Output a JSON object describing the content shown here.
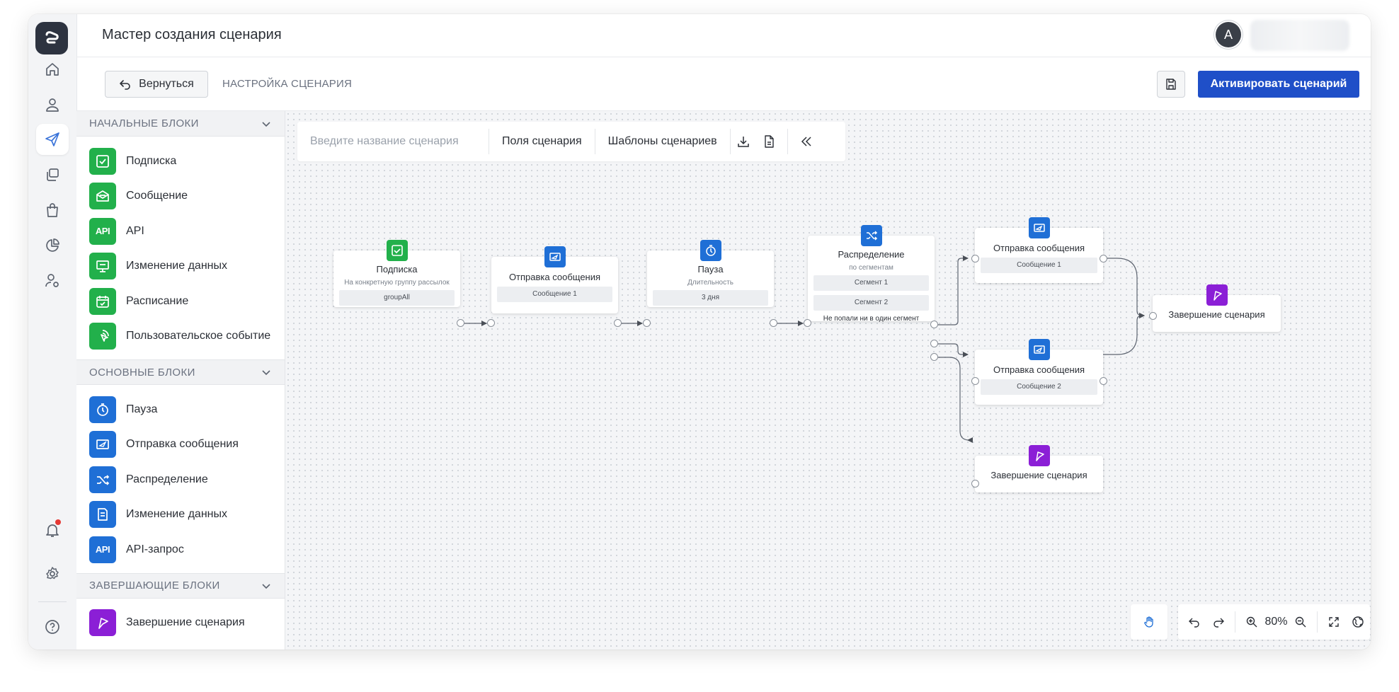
{
  "header": {
    "title": "Мастер создания сценария",
    "avatar_letter": "A"
  },
  "toolbar": {
    "back_label": "Вернуться",
    "breadcrumb": "НАСТРОЙКА СЦЕНАРИЯ",
    "activate_label": "Активировать сценарий"
  },
  "palette": {
    "sections": [
      {
        "title": "НАЧАЛЬНЫЕ БЛОКИ",
        "items": [
          {
            "label": "Подписка",
            "icon": "check-square-icon",
            "color": "#22b04b"
          },
          {
            "label": "Сообщение",
            "icon": "envelope-open-icon",
            "color": "#22b04b"
          },
          {
            "label": "API",
            "icon": "api-icon",
            "color": "#22b04b"
          },
          {
            "label": "Изменение данных",
            "icon": "data-edit-icon",
            "color": "#22b04b"
          },
          {
            "label": "Расписание",
            "icon": "calendar-icon",
            "color": "#22b04b"
          },
          {
            "label": "Пользовательское событие",
            "icon": "pointer-click-icon",
            "color": "#22b04b"
          }
        ]
      },
      {
        "title": "ОСНОВНЫЕ БЛОКИ",
        "items": [
          {
            "label": "Пауза",
            "icon": "timer-icon",
            "color": "#1f6fd6"
          },
          {
            "label": "Отправка сообщения",
            "icon": "message-send-icon",
            "color": "#1f6fd6"
          },
          {
            "label": "Распределение",
            "icon": "shuffle-icon",
            "color": "#1f6fd6"
          },
          {
            "label": "Изменение данных",
            "icon": "data-edit-icon",
            "color": "#1f6fd6"
          },
          {
            "label": "API-запрос",
            "icon": "api-icon",
            "color": "#1f6fd6"
          }
        ]
      },
      {
        "title": "ЗАВЕРШАЮЩИЕ БЛОКИ",
        "items": [
          {
            "label": "Завершение сценария",
            "icon": "flag-icon",
            "color": "#8b1fd6"
          }
        ]
      }
    ]
  },
  "canvas_toolbar": {
    "name_placeholder": "Введите название сценария",
    "fields_label": "Поля сценария",
    "templates_label": "Шаблоны сценариев"
  },
  "nodes": {
    "subscribe": {
      "title": "Подписка",
      "sub": "На конкретную группу рассылок",
      "chip": "groupAll"
    },
    "send1": {
      "title": "Отправка сообщения",
      "chip": "Сообщение 1"
    },
    "pause": {
      "title": "Пауза",
      "sub": "Длительность",
      "chip": "3 дня"
    },
    "distribution": {
      "title": "Распределение",
      "sub": "по сегментам",
      "seg1": "Сегмент 1",
      "seg2": "Сегмент 2",
      "seg3": "Не попали ни в один сегмент"
    },
    "send_top": {
      "title": "Отправка сообщения",
      "chip": "Сообщение 1"
    },
    "send_mid": {
      "title": "Отправка сообщения",
      "chip": "Сообщение 2"
    },
    "end_bottom": {
      "title": "Завершение сценария"
    },
    "end_right": {
      "title": "Завершение сценария"
    }
  },
  "zoom": {
    "level": "80%"
  },
  "colors": {
    "accent": "#1f4fc8",
    "start_blocks": "#22b04b",
    "main_blocks": "#1f6fd6",
    "end_blocks": "#8b1fd6"
  }
}
